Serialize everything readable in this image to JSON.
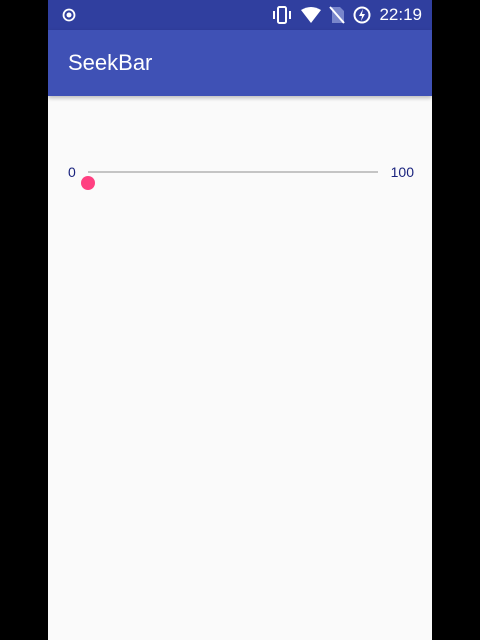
{
  "status_bar": {
    "time": "22:19",
    "icons": [
      "sync-circle-icon",
      "vibrate-icon",
      "wifi-icon",
      "no-sim-icon",
      "battery-charging-icon"
    ]
  },
  "app_bar": {
    "title": "SeekBar"
  },
  "seekbar": {
    "min_label": "0",
    "max_label": "100",
    "min": 0,
    "max": 100,
    "value": 0,
    "accent_color": "#ff4081"
  },
  "colors": {
    "status_bar": "#303f9f",
    "app_bar": "#3f51b5",
    "label": "#1a237e",
    "track": "#c4c4c4"
  }
}
